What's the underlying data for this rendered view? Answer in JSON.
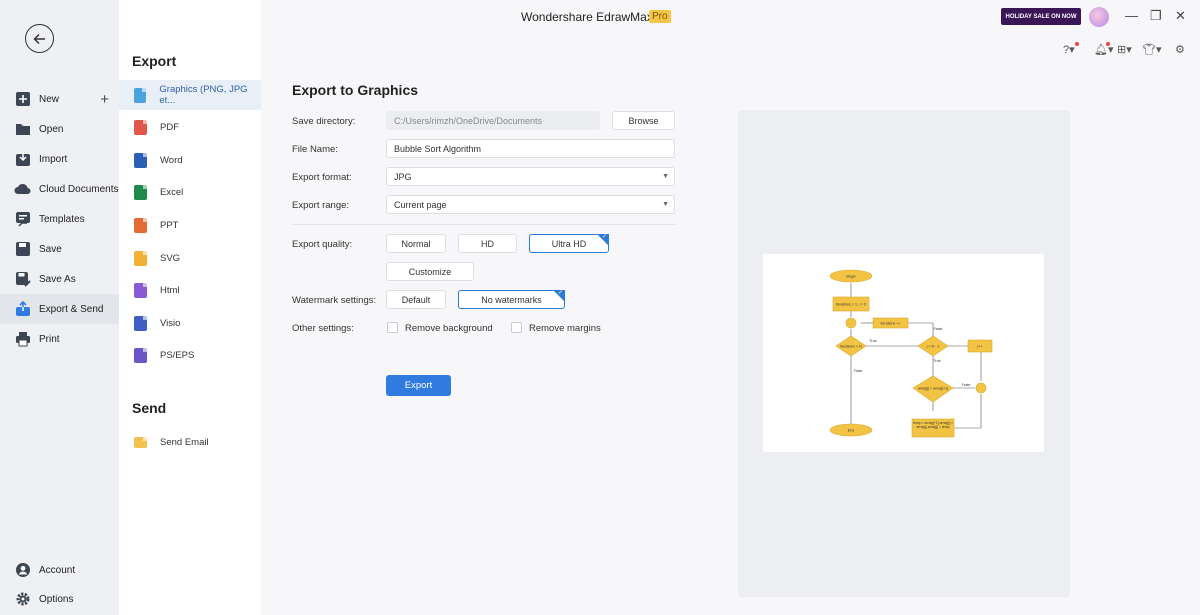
{
  "titlebar": {
    "app_name": "Wondershare EdrawMax",
    "badge": "Pro",
    "sale_banner": "HOLIDAY SALE ON NOW"
  },
  "leftnav": {
    "items": [
      {
        "label": "New",
        "icon": "plus-square-icon"
      },
      {
        "label": "Open",
        "icon": "folder-icon"
      },
      {
        "label": "Import",
        "icon": "import-icon"
      },
      {
        "label": "Cloud Documents",
        "icon": "cloud-icon"
      },
      {
        "label": "Templates",
        "icon": "templates-icon"
      },
      {
        "label": "Save",
        "icon": "save-icon"
      },
      {
        "label": "Save As",
        "icon": "save-as-icon"
      },
      {
        "label": "Export & Send",
        "icon": "export-icon"
      },
      {
        "label": "Print",
        "icon": "printer-icon"
      }
    ],
    "bottom": [
      {
        "label": "Account",
        "icon": "account-icon"
      },
      {
        "label": "Options",
        "icon": "gear-icon"
      }
    ]
  },
  "formats": {
    "export_title": "Export",
    "items": [
      {
        "label": "Graphics (PNG, JPG et...",
        "color": "#4aa3df"
      },
      {
        "label": "PDF",
        "color": "#e2574c"
      },
      {
        "label": "Word",
        "color": "#2b5fb5"
      },
      {
        "label": "Excel",
        "color": "#1f8a4c"
      },
      {
        "label": "PPT",
        "color": "#e46c34"
      },
      {
        "label": "SVG",
        "color": "#f2b134"
      },
      {
        "label": "Html",
        "color": "#8b5bd6"
      },
      {
        "label": "Visio",
        "color": "#3f5fc5"
      },
      {
        "label": "PS/EPS",
        "color": "#6b55c8"
      }
    ],
    "send_title": "Send",
    "send_items": [
      {
        "label": "Send Email",
        "color": "#f2c14e"
      }
    ]
  },
  "settings": {
    "title": "Export to Graphics",
    "save_dir_label": "Save directory:",
    "save_dir_value": "C:/Users/rimzh/OneDrive/Documents",
    "browse": "Browse",
    "file_name_label": "File Name:",
    "file_name_value": "Bubble Sort Algorithm",
    "format_label": "Export format:",
    "format_value": "JPG",
    "range_label": "Export range:",
    "range_value": "Current page",
    "quality_label": "Export quality:",
    "quality_options": [
      "Normal",
      "HD",
      "Ultra HD"
    ],
    "customize": "Customize",
    "watermark_label": "Watermark settings:",
    "watermark_options": [
      "Default",
      "No watermarks"
    ],
    "other_label": "Other settings:",
    "remove_background": "Remove background",
    "remove_margins": "Remove margins",
    "export_button": "Export"
  },
  "flowchart": {
    "begin": "Begin",
    "end": "End",
    "init": "Iterations = 1, i = 0",
    "iter_inc": "Iterations ++",
    "cond1": "Iterations < N",
    "cond2": "j < N - 1",
    "cond3": "array[j] > array[j+1]",
    "j_inc": "j++",
    "swap": "temp = array[j+1] array[j] = array[j] array[j] = temp",
    "true": "True",
    "false": "False"
  },
  "colors": {
    "accent": "#2f7be0",
    "flow_fill": "#f3c443",
    "flow_stroke": "#d9a82c"
  }
}
